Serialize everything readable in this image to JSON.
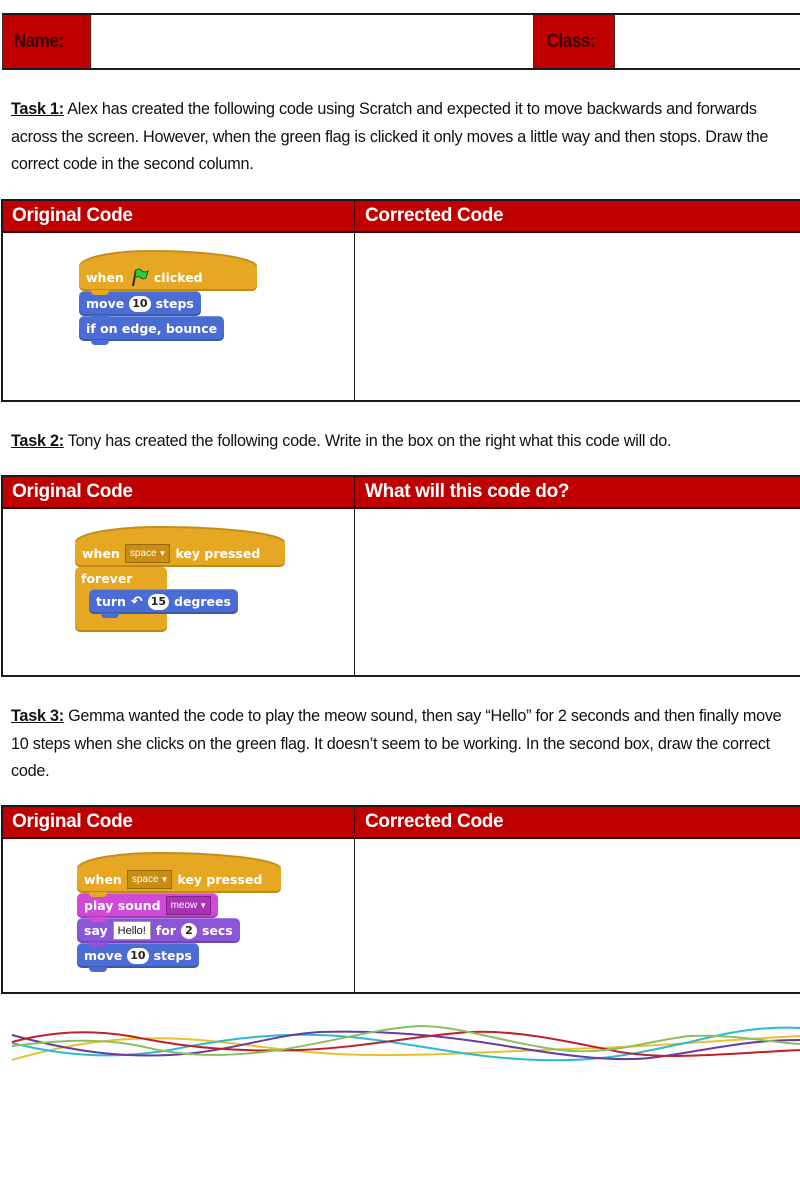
{
  "header": {
    "name_label": "Name:",
    "name_value": "",
    "class_label": "Class:",
    "class_value": ""
  },
  "tasks": [
    {
      "title": "Task 1:",
      "text": " Alex has created the following code using Scratch and expected it to move backwards and forwards across the screen.  However, when the green flag is clicked it only moves a little way and then stops.  Draw the correct code in the second column.",
      "table": {
        "col1_header": "Original Code",
        "col2_header": "Corrected Code",
        "answer": ""
      },
      "script": {
        "hat": {
          "pre": "when",
          "icon": "green-flag-icon",
          "post": "clicked"
        },
        "blocks": [
          {
            "category": "motion",
            "pre": "move",
            "value": "10",
            "post": "steps"
          },
          {
            "category": "motion",
            "text": "if on edge, bounce"
          }
        ]
      }
    },
    {
      "title": "Task 2:",
      "text": " Tony has created the following code.  Write in the box on the right what this code will do.",
      "table": {
        "col1_header": "Original Code",
        "col2_header": "What will this code do?",
        "answer": ""
      },
      "script": {
        "hat": {
          "pre": "when",
          "dropdown": "space",
          "post": "key pressed"
        },
        "loop": "forever",
        "inner": {
          "category": "motion",
          "pre": "turn",
          "icon": "rotate-left-icon",
          "value": "15",
          "post": "degrees"
        }
      }
    },
    {
      "title": "Task 3:",
      "text": " Gemma wanted the code to play the meow sound, then say “Hello” for 2 seconds and then finally move 10 steps when she clicks on the green flag.  It doesn’t seem to be working.  In the second box, draw the correct code.",
      "table": {
        "col1_header": "Original Code",
        "col2_header": "Corrected Code",
        "answer": ""
      },
      "script": {
        "hat": {
          "pre": "when",
          "dropdown": "space",
          "post": "key pressed"
        },
        "blocks": [
          {
            "category": "sound",
            "pre": "play sound",
            "dropdown": "meow"
          },
          {
            "category": "looks",
            "pre": "say",
            "text_input": "Hello!",
            "mid": "for",
            "value": "2",
            "post": "secs"
          },
          {
            "category": "motion",
            "pre": "move",
            "value": "10",
            "post": "steps"
          }
        ]
      }
    }
  ],
  "colors": {
    "header_red": "#c00000",
    "events_block": "#e6a822",
    "motion_block": "#4a6cd4",
    "sound_block": "#cf4ad9",
    "looks_block": "#8a55d7",
    "wave_colors": [
      "#e8c030",
      "#2eb8d8",
      "#6a3aa0",
      "#c0202a",
      "#8ac060"
    ]
  }
}
